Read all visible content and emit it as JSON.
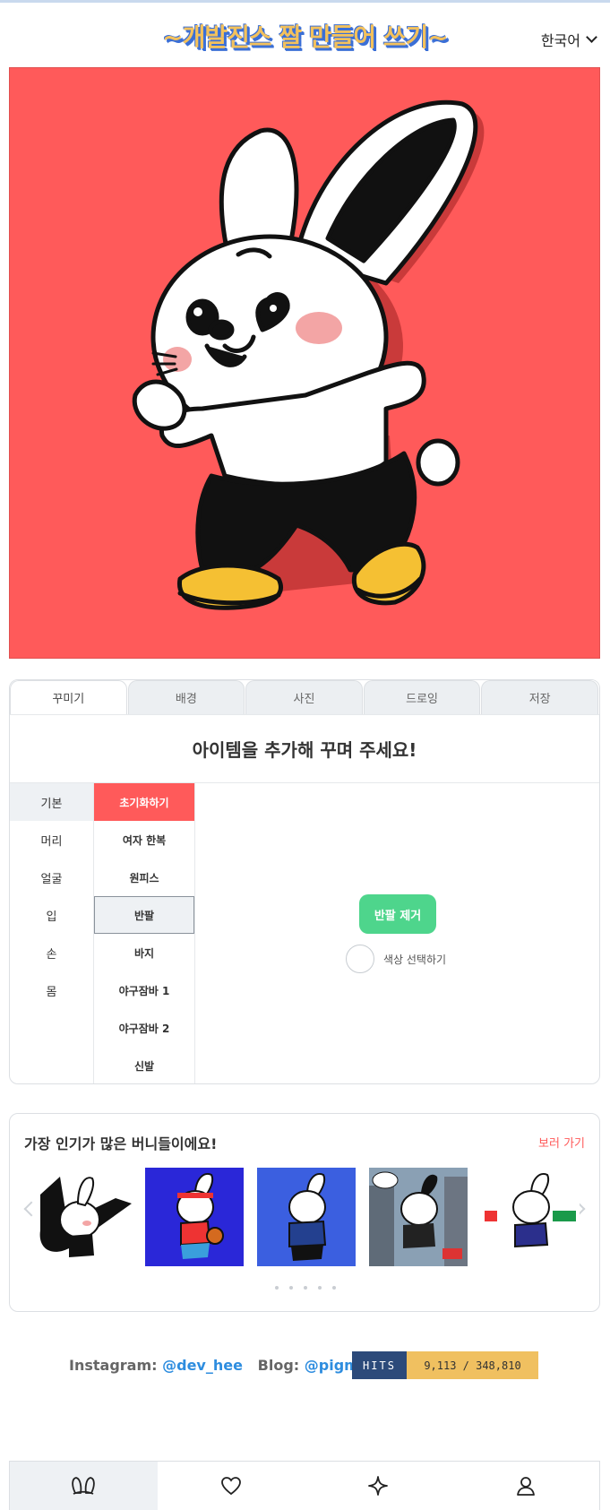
{
  "header": {
    "title": "~개발진스 짤 만들어 쓰기~",
    "language": "한국어"
  },
  "colors": {
    "canvas_background": "#ff5a5a",
    "accent_red": "#ff5a5a",
    "accent_green": "#4ed58c",
    "link_blue": "#2e8ddf"
  },
  "editor": {
    "tabs": [
      {
        "label": "꾸미기",
        "active": true
      },
      {
        "label": "배경"
      },
      {
        "label": "사진"
      },
      {
        "label": "드로잉"
      },
      {
        "label": "저장"
      }
    ],
    "heading": "아이템을 추가해 꾸며 주세요!",
    "categories": [
      "기본",
      "머리",
      "얼굴",
      "입",
      "손",
      "몸"
    ],
    "active_category": "기본",
    "sub_items": [
      "초기화하기",
      "여자 한복",
      "원피스",
      "반팔",
      "바지",
      "야구잠바 1",
      "야구잠바 2",
      "신발"
    ],
    "selected_sub_item": "반팔",
    "remove_button": "반팔 제거",
    "color_picker_label": "색상 선택하기"
  },
  "popular": {
    "title": "가장 인기가 많은 버니들이에요!",
    "link": "보러 가기",
    "slide_count": 5
  },
  "footer": {
    "instagram_label": "Instagram:",
    "instagram_handle": "@dev_hee",
    "blog_label": "Blog:",
    "blog_handle": "@pigme",
    "hits_label": "HITS",
    "hits_value": "9,113 / 348,810"
  },
  "bottom_nav": {
    "icons": [
      "bunny-ears-icon",
      "heart-icon",
      "sparkle-icon",
      "user-icon"
    ],
    "active": "bunny-ears-icon"
  }
}
